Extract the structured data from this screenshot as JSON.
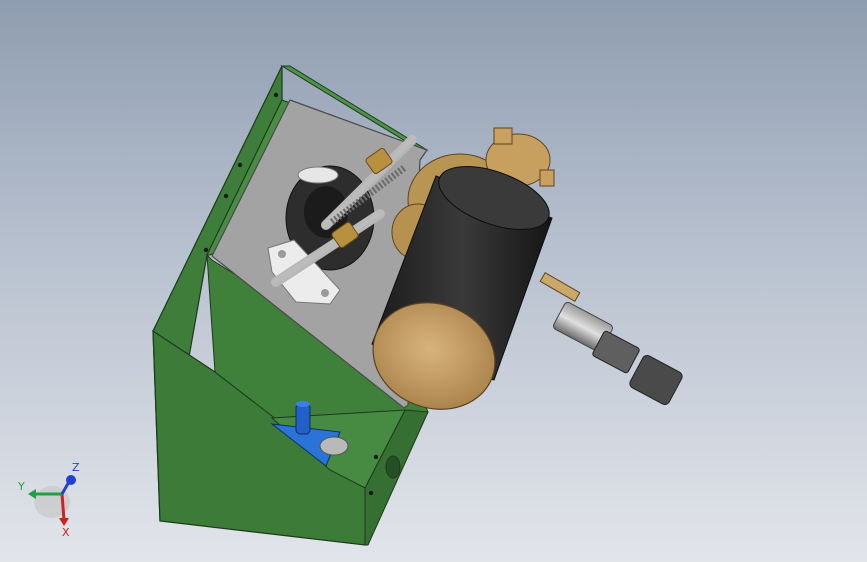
{
  "viewport": {
    "background_top": "#8f9db0",
    "background_bottom": "#e2e5ea"
  },
  "model": {
    "housing_color": "#3b7a37",
    "plate_color": "#9a9a9a",
    "motor_body_color": "#2a2a2a",
    "motor_cap_color": "#c9a46e",
    "gear_color": "#303030",
    "brass_color": "#b08a3e",
    "bracket_color": "#2a6fd6",
    "knob_color": "#1f5fbf"
  },
  "triad": {
    "x_label": "X",
    "y_label": "Y",
    "z_label": "Z",
    "x_color": "#d02020",
    "y_color": "#20a040",
    "z_color": "#2040d0"
  }
}
